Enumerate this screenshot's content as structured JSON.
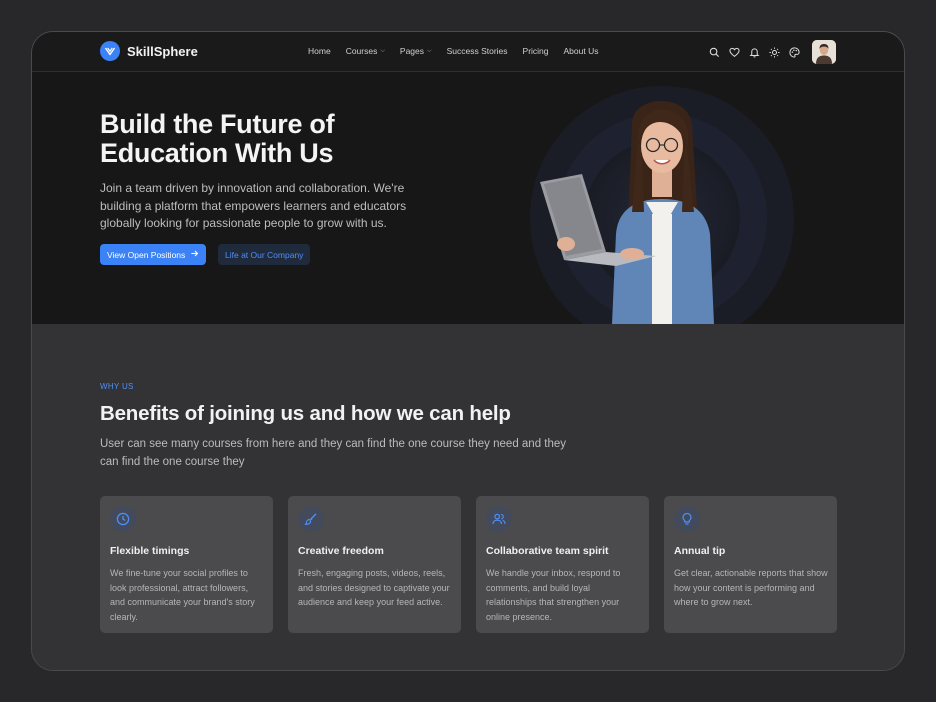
{
  "nav": {
    "brand": "SkillSphere",
    "menu": [
      {
        "label": "Home",
        "dropdown": false
      },
      {
        "label": "Courses",
        "dropdown": true
      },
      {
        "label": "Pages",
        "dropdown": true
      },
      {
        "label": "Success Stories",
        "dropdown": false
      },
      {
        "label": "Pricing",
        "dropdown": false
      },
      {
        "label": "About Us",
        "dropdown": false
      }
    ],
    "icons": [
      "search-icon",
      "heart-icon",
      "bell-icon",
      "sun-icon",
      "palette-icon"
    ]
  },
  "hero": {
    "title_line1": "Build the Future of",
    "title_line2": "Education With Us",
    "description": "Join a team driven by innovation and collaboration. We're building a platform that empowers learners and educators globally looking for passionate people to grow with us.",
    "primary_button": "View Open Positions",
    "secondary_button": "Life at Our Company"
  },
  "benefits": {
    "eyebrow": "WHY US",
    "title": "Benefits of joining us and how we can help",
    "description": "User can see many courses from here and they can find the one course they need and they can find the one course they",
    "cards": [
      {
        "icon": "clock-icon",
        "title": "Flexible timings",
        "text": "We fine-tune your social profiles to look professional, attract followers, and communicate your brand's story clearly."
      },
      {
        "icon": "brush-icon",
        "title": "Creative freedom",
        "text": "Fresh, engaging posts, videos, reels, and stories designed to captivate your audience and keep your feed active."
      },
      {
        "icon": "users-icon",
        "title": "Collaborative team spirit",
        "text": "We handle your inbox, respond to comments, and build loyal relationships that strengthen your online presence."
      },
      {
        "icon": "lightbulb-icon",
        "title": "Annual tip",
        "text": "Get clear, actionable reports that show how your content is performing and where to grow next."
      }
    ]
  },
  "colors": {
    "accent": "#3b82f6",
    "background": "#28282a",
    "hero_bg": "#171718",
    "card_bg": "#4b4b4e"
  }
}
